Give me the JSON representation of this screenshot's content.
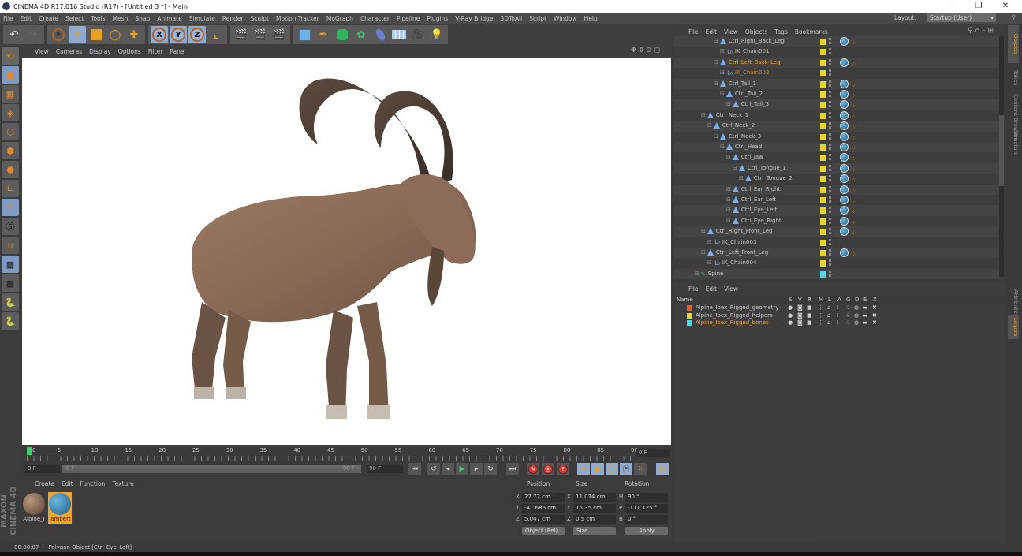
{
  "window": {
    "title": "CINEMA 4D R17.016 Studio (R17) - [Untitled 3 *] - Main",
    "controls": [
      "—",
      "❐",
      "✕"
    ]
  },
  "menu": [
    "File",
    "Edit",
    "Create",
    "Select",
    "Tools",
    "Mesh",
    "Snap",
    "Animate",
    "Simulate",
    "Render",
    "Sculpt",
    "Motion Tracker",
    "MoGraph",
    "Character",
    "Pipeline",
    "Plugins",
    "V-Ray Bridge",
    "3DToAll",
    "Script",
    "Window",
    "Help"
  ],
  "layout": {
    "label": "Layout:",
    "value": "Startup (User)"
  },
  "toolbar": {
    "undo": "undo-icon",
    "groups": [
      [
        "select-arrow",
        "move",
        "scale",
        "rotate",
        "recent-tool"
      ],
      [
        "x-axis",
        "y-axis",
        "z-axis",
        "coordinate-system"
      ],
      [
        "render-view",
        "render-picture-viewer",
        "edit-render-settings"
      ],
      [
        "cube",
        "pen",
        "subdivision",
        "cloner",
        "deformer",
        "floor",
        "camera",
        "light"
      ]
    ],
    "axis_labels": [
      "X",
      "Y",
      "Z"
    ]
  },
  "viewport": {
    "menu": [
      "View",
      "Cameras",
      "Display",
      "Options",
      "Filter",
      "Panel"
    ],
    "subject": "Alpine Ibex rigged 3D model"
  },
  "timeline": {
    "ticks": [
      "0",
      "5",
      "10",
      "15",
      "20",
      "25",
      "30",
      "35",
      "40",
      "45",
      "50",
      "55",
      "60",
      "65",
      "70",
      "75",
      "80",
      "85",
      "90"
    ],
    "current_frame": "0 F",
    "end_frame_display": "0 F",
    "start_field": "0 F",
    "slider_start": "0 F",
    "slider_end": "90 F",
    "end_field": "90 F"
  },
  "materials": {
    "menu": [
      "Create",
      "Edit",
      "Function",
      "Texture"
    ],
    "items": [
      {
        "label": "Alpine_I",
        "selected": false,
        "color": "#8a6a4f"
      },
      {
        "label": "lambert",
        "selected": true,
        "color": "#3f8fb8"
      }
    ]
  },
  "coordinates": {
    "headers": [
      "Position",
      "Size",
      "Rotation"
    ],
    "rows": [
      {
        "axis": "X",
        "position": "27.72 cm",
        "size_axis": "X",
        "size": "11.074 cm",
        "rot_axis": "H",
        "rotation": "90 °"
      },
      {
        "axis": "Y",
        "position": "-47.686 cm",
        "size_axis": "Y",
        "size": "15.35 cm",
        "rot_axis": "P",
        "rotation": "-111.125 °"
      },
      {
        "axis": "Z",
        "position": "5.047 cm",
        "size_axis": "Z",
        "size": "0.5 cm",
        "rot_axis": "B",
        "rotation": "0 °"
      }
    ],
    "mode_dropdown": "Object (Rel)",
    "size_dropdown": "Size",
    "apply_label": "Apply"
  },
  "status": {
    "time": "00:00:07",
    "message": "Polygon Object [Ctrl_Eye_Left]"
  },
  "objects": {
    "menu": [
      "File",
      "Edit",
      "View",
      "Objects",
      "Tags",
      "Bookmarks"
    ],
    "rows": [
      {
        "name": "Ctrl_Right_Back_Leg",
        "indent": 4,
        "type": "joint",
        "swatch": "#e6d52a",
        "tag": true,
        "state": ""
      },
      {
        "name": "IK_Chain001",
        "indent": 5,
        "type": "ik",
        "swatch": "#e6d52a",
        "tag": false,
        "state": ""
      },
      {
        "name": "Ctrl_Left_Back_Leg",
        "indent": 4,
        "type": "joint",
        "swatch": "#e6d52a",
        "tag": true,
        "state": "selected"
      },
      {
        "name": "IK_Chain002",
        "indent": 5,
        "type": "ik",
        "swatch": "#e6d52a",
        "tag": false,
        "state": "child-selected"
      },
      {
        "name": "Ctrl_Tail_1",
        "indent": 4,
        "type": "joint",
        "swatch": "#e6d52a",
        "tag": true,
        "state": ""
      },
      {
        "name": "Ctrl_Tail_2",
        "indent": 5,
        "type": "joint",
        "swatch": "#e6d52a",
        "tag": true,
        "state": ""
      },
      {
        "name": "Ctrl_Tail_3",
        "indent": 6,
        "type": "joint",
        "swatch": "#e6d52a",
        "tag": true,
        "state": ""
      },
      {
        "name": "Ctrl_Neck_1",
        "indent": 2,
        "type": "joint",
        "swatch": "#e6d52a",
        "tag": true,
        "state": ""
      },
      {
        "name": "Ctrl_Neck_2",
        "indent": 3,
        "type": "joint",
        "swatch": "#e6d52a",
        "tag": true,
        "state": ""
      },
      {
        "name": "Ctrl_Neck_3",
        "indent": 4,
        "type": "joint",
        "swatch": "#e6d52a",
        "tag": true,
        "state": ""
      },
      {
        "name": "Ctrl_Head",
        "indent": 5,
        "type": "joint",
        "swatch": "#e6d52a",
        "tag": true,
        "state": ""
      },
      {
        "name": "Ctrl_Jaw",
        "indent": 6,
        "type": "joint",
        "swatch": "#e6d52a",
        "tag": true,
        "state": ""
      },
      {
        "name": "Ctrl_Tongue_1",
        "indent": 7,
        "type": "joint",
        "swatch": "#e6d52a",
        "tag": true,
        "state": ""
      },
      {
        "name": "Ctrl_Tongue_2",
        "indent": 8,
        "type": "joint",
        "swatch": "#e6d52a",
        "tag": true,
        "state": ""
      },
      {
        "name": "Ctrl_Ear_Right",
        "indent": 6,
        "type": "joint",
        "swatch": "#e6d52a",
        "tag": true,
        "state": ""
      },
      {
        "name": "Ctrl_Ear_Left",
        "indent": 6,
        "type": "joint",
        "swatch": "#e6d52a",
        "tag": true,
        "state": ""
      },
      {
        "name": "Ctrl_Eye_Left",
        "indent": 6,
        "type": "joint",
        "swatch": "#e6d52a",
        "tag": true,
        "state": ""
      },
      {
        "name": "Ctrl_Eye_Right",
        "indent": 6,
        "type": "joint",
        "swatch": "#e6d52a",
        "tag": true,
        "state": ""
      },
      {
        "name": "Ctrl_Right_Front_Leg",
        "indent": 2,
        "type": "joint",
        "swatch": "#e6d52a",
        "tag": true,
        "state": ""
      },
      {
        "name": "IK_Chain003",
        "indent": 3,
        "type": "ik",
        "swatch": "#e6d52a",
        "tag": false,
        "state": ""
      },
      {
        "name": "Ctrl_Left_Front_Leg",
        "indent": 2,
        "type": "joint",
        "swatch": "#e6d52a",
        "tag": true,
        "state": ""
      },
      {
        "name": "IK_Chain004",
        "indent": 3,
        "type": "ik",
        "swatch": "#e6d52a",
        "tag": false,
        "state": ""
      },
      {
        "name": "Spine",
        "indent": 1,
        "type": "spline",
        "swatch": "#4fd8e6",
        "tag": false,
        "state": ""
      }
    ]
  },
  "side_tabs": [
    "Objects",
    "Takes",
    "Content Browser",
    "Structure"
  ],
  "side_tabs_lower": [
    "Attributes",
    "Layers"
  ],
  "layers": {
    "menu": [
      "File",
      "Edit",
      "View"
    ],
    "columns": [
      "Name",
      "S",
      "V",
      "R",
      "M",
      "L",
      "A",
      "G",
      "D",
      "E",
      "X"
    ],
    "rows": [
      {
        "name": "Alpine_Ibex_Rigged_geometry",
        "color": "#e0642a",
        "selected": false
      },
      {
        "name": "Alpine_Ibex_Rigged_helpers",
        "color": "#e6d52a",
        "selected": false
      },
      {
        "name": "Alpine_Ibex_Rigged_bones",
        "color": "#4fd8e6",
        "selected": true
      }
    ]
  },
  "brand": "MAXON CINEMA 4D"
}
